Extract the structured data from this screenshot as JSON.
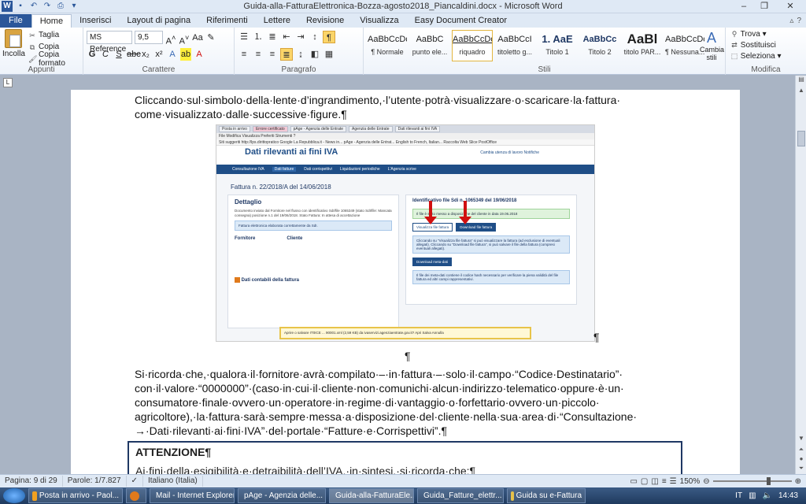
{
  "window": {
    "title": "Guida-alla-FatturaElettronica-Bozza-agosto2018_Piancaldini.docx - Microsoft Word"
  },
  "tabs": [
    "File",
    "Home",
    "Inserisci",
    "Layout di pagina",
    "Riferimenti",
    "Lettere",
    "Revisione",
    "Visualizza",
    "Easy Document Creator"
  ],
  "ribbon": {
    "appunti": {
      "label": "Appunti",
      "paste": "Incolla",
      "cut": "Taglia",
      "copy": "Copia",
      "format_painter": "Copia formato"
    },
    "carattere": {
      "label": "Carattere",
      "font": "MS Reference",
      "size": "9,5"
    },
    "paragrafo": {
      "label": "Paragrafo"
    },
    "stili": {
      "label": "Stili",
      "items": [
        {
          "sample": "AaBbCcDc",
          "name": "¶ Normale"
        },
        {
          "sample": "AaBbC",
          "name": "punto ele..."
        },
        {
          "sample": "AaBbCcDc",
          "name": "riquadro"
        },
        {
          "sample": "AaBbCcI",
          "name": "titoletto g..."
        },
        {
          "sample": "1. AaE",
          "name": "Titolo 1"
        },
        {
          "sample": "AaBbCc",
          "name": "Titolo 2"
        },
        {
          "sample": "AaBl",
          "name": "titolo PAR..."
        },
        {
          "sample": "AaBbCcDc",
          "name": "¶ Nessuna..."
        }
      ],
      "change_styles": "Cambia stili"
    },
    "modifica": {
      "label": "Modifica",
      "find": "Trova",
      "replace": "Sostituisci",
      "select": "Seleziona"
    }
  },
  "document": {
    "para1": "Cliccando·sul·simbolo·della·lente·d’ingrandimento,·l’utente·potrà·visualizzare·o·scaricare·la·fattura· come·visualizzato·dalle·successive·figure.¶",
    "pilcrow": "¶",
    "para2": "Si·ricorda·che,·qualora·il·fornitore·avrà·compilato·–·in·fattura·–·solo·il·campo·“Codice·Destinatario”· con·il·valore·“0000000”·(caso·in·cui·il·cliente·non·comunichi·alcun·indirizzo·telematico·oppure·è·un· consumatore·finale·ovvero·un·operatore·in·regime·di·vantaggio·o·forfettario·ovvero·un·piccolo· agricoltore),·la·fattura·sarà·sempre·messa·a·disposizione·del·cliente·nella·sua·area·di·“Consultazione· →·Dati·rilevanti·ai·fini·IVA”·del·portale·“Fatture·e·Corrispettivi”.¶",
    "attention_title": "ATTENZIONE¶",
    "attention_text": "Ai·fini·della·esigibilità·e·detraibilità·dell’IVA,·in·sintesi,·si·ricorda·che:¶",
    "figure": {
      "browser_tabs": [
        "Posta in arrivo",
        "Errore certificato",
        "pAge - Agenzia delle Entrate",
        "Agenzia delle Entrate",
        "Dati rilevanti ai fini IVA"
      ],
      "menu": "File  Modifica  Visualizza  Preferiti  Strumenti  ?",
      "favorites": "Siti suggeriti   http://lps.dirittopratico   Google   La Repubblica.it - News in...   pAge - Agenzia delle Entrat...   English to French, Italian...   Raccolta Web Slice   PostOffice",
      "header_title": "Dati rilevanti ai fini IVA",
      "header_links": "Cambia utenza di lavoro   Notifiche",
      "nav": [
        "Consultazione IVA",
        "Dati fatture",
        "Dati corrispettivi",
        "Liquidazioni periodiche",
        "L'Agenzia scrive"
      ],
      "invoice_title": "Fattura n. 22/2018/A del 14/06/2018",
      "detail_title": "Dettaglio",
      "detail_text": "Documento inviato dal Fornitore nel flusso con identificativo SdI/file 1065349 (stato SdI/file: Mancata consegna) posizione n.1 del 19/06/2018. Stato Fattura: In attesa di accettazione",
      "detail_note": "Fattura elettronica elaborata correttamente da SdI.",
      "supplier": "Fornitore",
      "customer": "Cliente",
      "accounting_title": "Dati contabili della fattura",
      "right_title": "Identificativo file Sdi n. 1065349 del 19/06/2018",
      "green_note": "Il file è stato messo a disposizione del cliente in data 19.06.2018",
      "btn_view": "Visualizza file fattura",
      "btn_download": "Download file fattura",
      "blue_note": "Cliccando su \"Visualizza file fattura\" si può visualizzare la fattura (ad esclusione di eventuali allegati). Cliccando su \"Download file fattura\", si può salvare il file della fattura (compresi eventuali allegati).",
      "btn_meta": "Download meta-dati",
      "meta_note": "Il file dei meta-dati contiene il codice hash necessario per verificare la piena validità del file fattura ed altri campi rappresentativi.",
      "download_bar": "Aprire o salvare IT0ICE  ...  90001.xml (2,59 KB) da ivaservizi.agenziaentrate.gov.it?     Apri    Salva    Annulla"
    }
  },
  "statusbar": {
    "page": "Pagina: 9 di 29",
    "words": "Parole: 1/7.827",
    "lang": "Italiano (Italia)",
    "zoom": "150%"
  },
  "taskbar": {
    "items": [
      {
        "label": "Posta in arrivo - Paol...",
        "color": "#f0a020"
      },
      {
        "label": "",
        "color": "#e07a1c"
      },
      {
        "label": "Mail - Internet Explorer",
        "color": "#3a8ad8"
      },
      {
        "label": "pAge - Agenzia delle...",
        "color": "#e07a1c"
      },
      {
        "label": "Guida-alla-FatturaEle...",
        "color": "#2b579a"
      },
      {
        "label": "Guida_Fatture_elettr...",
        "color": "#2b579a"
      },
      {
        "label": "Guida su e-Fattura",
        "color": "#e6c14a"
      }
    ],
    "lang": "IT",
    "clock": "14:43"
  },
  "colors": {
    "word_blue": "#2b579a",
    "arrow_red": "#d01010",
    "portal_blue": "#1f4e87"
  }
}
